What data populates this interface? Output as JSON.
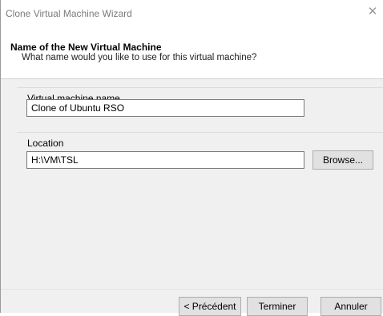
{
  "window": {
    "title": "Clone Virtual Machine Wizard",
    "close_glyph": "✕"
  },
  "header": {
    "title": "Name of the New Virtual Machine",
    "subtitle": "What name would you like to use for this virtual machine?"
  },
  "form": {
    "vm_name_label": "Virtual machine name",
    "vm_name_value": "Clone of Ubuntu RSO",
    "location_label": "Location",
    "location_value": "H:\\VM\\TSL",
    "browse_label": "Browse..."
  },
  "footer": {
    "back_label": "< Précédent",
    "finish_label": "Terminer",
    "cancel_label": "Annuler"
  }
}
